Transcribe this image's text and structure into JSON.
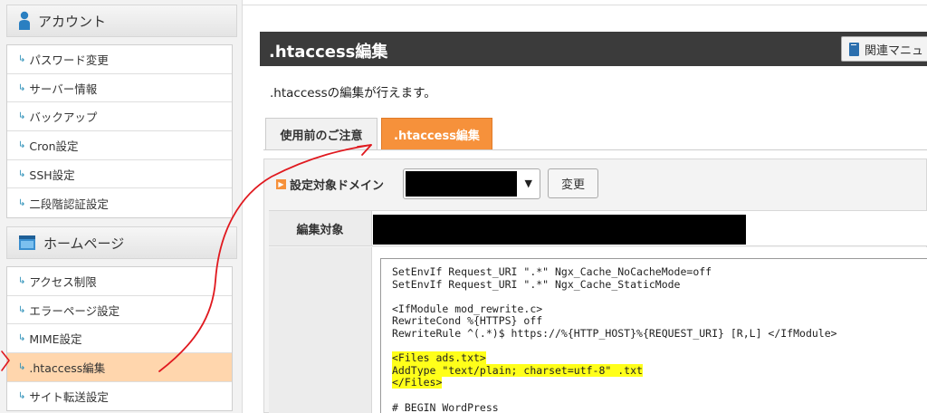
{
  "sidebar": {
    "account": {
      "title": "アカウント",
      "items": [
        "パスワード変更",
        "サーバー情報",
        "バックアップ",
        "Cron設定",
        "SSH設定",
        "二段階認証設定"
      ]
    },
    "homepage": {
      "title": "ホームページ",
      "items": [
        "アクセス制限",
        "エラーページ設定",
        "MIME設定",
        ".htaccess編集",
        "サイト転送設定"
      ]
    }
  },
  "main": {
    "title": ".htaccess編集",
    "manual_button": "関連マニュ",
    "description": ".htaccessの編集が行えます。",
    "tabs": [
      ".htaccess編集",
      "使用前のご注意"
    ],
    "domain_label": "設定対象ドメイン",
    "change_button": "変更",
    "target_label": "編集対象",
    "editor": {
      "lines_before": [
        "SetEnvIf Request_URI \".*\" Ngx_Cache_NoCacheMode=off",
        "SetEnvIf Request_URI \".*\" Ngx_Cache_StaticMode",
        "",
        "<IfModule mod_rewrite.c>",
        "RewriteCond %{HTTPS} off",
        "RewriteRule ^(.*)$ https://%{HTTP_HOST}%{REQUEST_URI} [R,L] </IfModule>",
        ""
      ],
      "highlighted": [
        "<Files ads.txt>",
        "AddType \"text/plain; charset=utf-8\" .txt",
        "</Files>"
      ],
      "lines_after": [
        "",
        "# BEGIN WordPress"
      ]
    }
  },
  "colors": {
    "accent_orange": "#f6913b",
    "active_menu": "#ffd6ad",
    "title_bar": "#3b3b3b",
    "highlight": "#ffff1a",
    "annotation": "#e0191f"
  }
}
